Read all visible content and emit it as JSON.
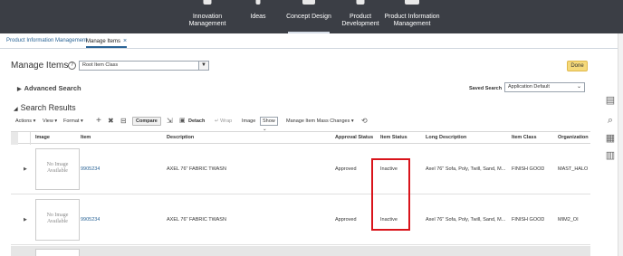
{
  "topnav": {
    "items": [
      {
        "label": "Innovation\nManagement"
      },
      {
        "label": "Ideas"
      },
      {
        "label": "Concept Design"
      },
      {
        "label": "Product\nDevelopment"
      },
      {
        "label": "Product Information\nManagement"
      }
    ]
  },
  "tabs": {
    "pim": "Product Information Management",
    "manage": "Manage Items",
    "close": "×"
  },
  "header": {
    "title": "Manage Items",
    "help": "?",
    "item_class_value": "Root Item Class",
    "done": "Done"
  },
  "advanced_search": {
    "label": "Advanced Search",
    "saved_search_label": "Saved Search",
    "saved_search_value": "Application Default"
  },
  "search_results": {
    "label": "Search Results",
    "toolbar": {
      "actions": "Actions ▾",
      "view": "View ▾",
      "format": "Format ▾",
      "compare": "Compare",
      "detach": "Detach",
      "wrap": "Wrap",
      "image": "Image",
      "image_mode": "Show",
      "mass_changes": "Manage Item Mass Changes ▾"
    },
    "columns": [
      "Image",
      "Item",
      "Description",
      "Approval Status",
      "Item Status",
      "Long Description",
      "Item Class",
      "Organization"
    ],
    "rows": [
      {
        "image": "No Image\nAvailable",
        "item": "9905234",
        "description": "AXEL 76\" FABRIC TWASN",
        "approval_status": "Approved",
        "item_status": "Inactive",
        "long_description": "Axel 76\" Sofa, Poly, Twill, Sand, M...",
        "item_class": "FINISH GOOD",
        "organization": "MAST_HALO"
      },
      {
        "image": "No Image\nAvailable",
        "item": "9905234",
        "description": "AXEL 76\" FABRIC TWASN",
        "approval_status": "Approved",
        "item_status": "Inactive",
        "long_description": "Axel 76\" Sofa, Poly, Twill, Sand, M...",
        "item_class": "FINISH GOOD",
        "organization": "MIM2_OI"
      }
    ]
  },
  "colors": {
    "nav_bg": "#3b3e45",
    "link": "#2a6496",
    "done_bg": "#f5d97a",
    "highlight": "#d9141b"
  }
}
